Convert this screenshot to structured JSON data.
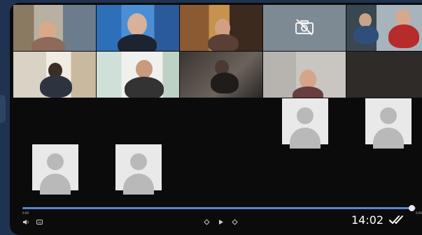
{
  "message": {
    "time": "14:02",
    "read_icon": "double-check-icon"
  },
  "player": {
    "progress_percent": 99,
    "time_left": "0:00",
    "time_right": "0:00"
  },
  "camera_off_icon": "camera-off-icon",
  "participants_row1": [
    "",
    "",
    "",
    "",
    ""
  ],
  "participants_row2": [
    "",
    "",
    "",
    "",
    ""
  ],
  "participants_row3": [
    "",
    "",
    "",
    "",
    ""
  ],
  "participants_row4": [
    "",
    "",
    "",
    "",
    ""
  ],
  "colors": {
    "accent": "#4f8ad6",
    "background": "#1f3350"
  }
}
